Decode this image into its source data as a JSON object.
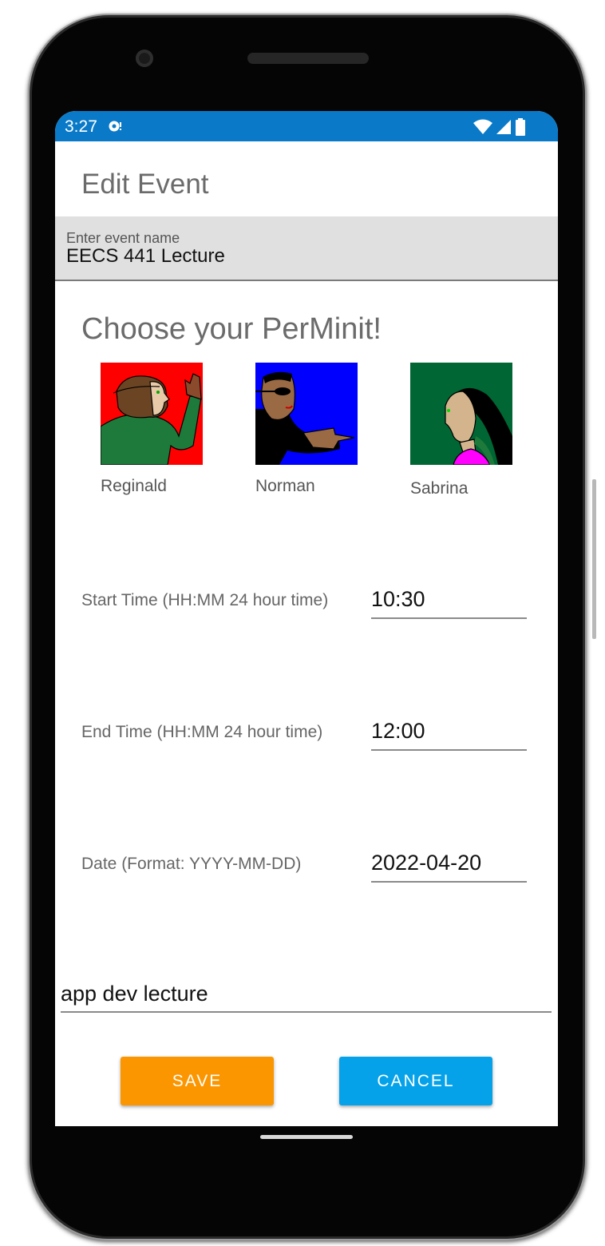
{
  "status_bar": {
    "time": "3:27",
    "bg_color": "#0a7ac8",
    "icons": [
      "notification-icon",
      "wifi-icon",
      "signal-icon",
      "battery-icon"
    ]
  },
  "app_bar": {
    "title": "Edit Event"
  },
  "event_name": {
    "label": "Enter event name",
    "value": "EECS 441 Lecture"
  },
  "chooser": {
    "heading": "Choose your PerMinit!",
    "characters": [
      {
        "name": "Reginald",
        "bg_color": "#ff0000"
      },
      {
        "name": "Norman",
        "bg_color": "#0000ff"
      },
      {
        "name": "Sabrina",
        "bg_color": "#006633"
      }
    ]
  },
  "fields": {
    "start_time": {
      "label": "Start Time (HH:MM 24 hour time)",
      "value": "10:30"
    },
    "end_time": {
      "label": "End Time (HH:MM 24 hour time)",
      "value": "12:00"
    },
    "date": {
      "label": "Date (Format: YYYY-MM-DD)",
      "value": "2022-04-20"
    }
  },
  "notes": {
    "value": "app dev lecture"
  },
  "buttons": {
    "save": {
      "label": "SAVE",
      "color": "#fb9600"
    },
    "cancel": {
      "label": "CANCEL",
      "color": "#05a2ea"
    }
  }
}
